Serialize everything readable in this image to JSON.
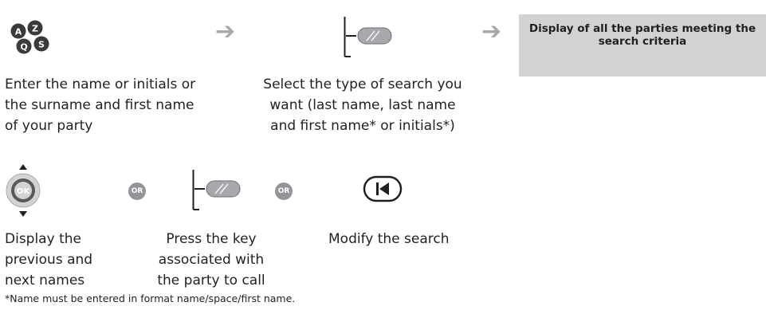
{
  "keypad_icon": {
    "icon": "keypad-letters-icon",
    "letters": [
      "A",
      "Z",
      "Q",
      "S"
    ]
  },
  "arrow_glyph": "➔",
  "steps": {
    "enter": {
      "lines": [
        "Enter the name or initials or",
        "the surname and first name",
        "of your party"
      ]
    },
    "select": {
      "icon": "line-key-icon",
      "lines": [
        "Select the type of search you",
        "want (last name, last name",
        "and first name* or initials*)"
      ]
    },
    "result": {
      "lines": [
        "Display of all the parties meeting the",
        "search criteria"
      ],
      "bg": "#d0d2d3"
    }
  },
  "options": {
    "or_label": "OR",
    "navigator": {
      "icon": "navigator-ok-icon",
      "ok_label": "OK",
      "lines": [
        "Display the",
        "previous and",
        "next names"
      ]
    },
    "press_key": {
      "icon": "line-key-icon",
      "lines": [
        "Press the key",
        "associated with",
        "the party to call"
      ]
    },
    "modify": {
      "icon": "back-key-icon",
      "lines": [
        "Modify the search"
      ]
    }
  },
  "footnote": "*Name must be entered in format name/space/first name."
}
